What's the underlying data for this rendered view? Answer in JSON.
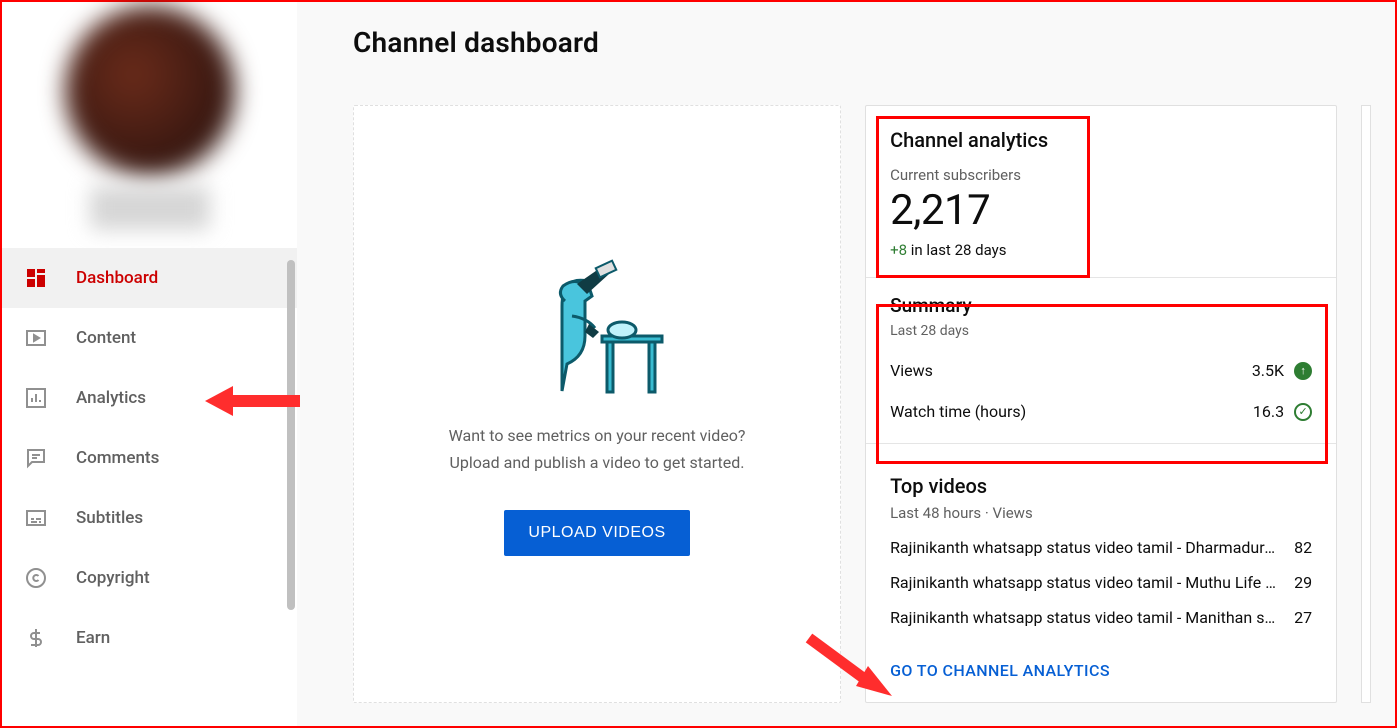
{
  "page": {
    "title": "Channel dashboard"
  },
  "sidebar": {
    "items": [
      {
        "label": "Dashboard",
        "name": "dashboard",
        "active": true
      },
      {
        "label": "Content",
        "name": "content",
        "active": false
      },
      {
        "label": "Analytics",
        "name": "analytics",
        "active": false
      },
      {
        "label": "Comments",
        "name": "comments",
        "active": false
      },
      {
        "label": "Subtitles",
        "name": "subtitles",
        "active": false
      },
      {
        "label": "Copyright",
        "name": "copyright",
        "active": false
      },
      {
        "label": "Earn",
        "name": "earn",
        "active": false
      }
    ]
  },
  "upload_card": {
    "prompt_line1": "Want to see metrics on your recent video?",
    "prompt_line2": "Upload and publish a video to get started.",
    "button": "UPLOAD VIDEOS"
  },
  "analytics": {
    "heading": "Channel analytics",
    "subscribers_label": "Current subscribers",
    "subscribers_count": "2,217",
    "delta_value": "+8",
    "delta_suffix": " in last 28 days",
    "summary": {
      "heading": "Summary",
      "period": "Last 28 days",
      "metrics": [
        {
          "label": "Views",
          "value": "3.5K",
          "trend": "up"
        },
        {
          "label": "Watch time (hours)",
          "value": "16.3",
          "trend": "flat"
        }
      ]
    },
    "top_videos": {
      "heading": "Top videos",
      "period": "Last 48 hours · Views",
      "rows": [
        {
          "title": "Rajinikanth whatsapp status video tamil - Dharmadura…",
          "views": "82"
        },
        {
          "title": "Rajinikanth whatsapp status video tamil - Muthu Life D…",
          "views": "29"
        },
        {
          "title": "Rajinikanth whatsapp status video tamil - Manithan so…",
          "views": "27"
        }
      ]
    },
    "goto_link": "GO TO CHANNEL ANALYTICS"
  }
}
